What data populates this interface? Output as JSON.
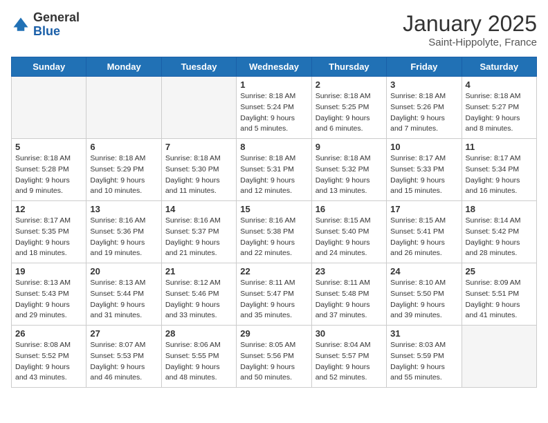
{
  "logo": {
    "general": "General",
    "blue": "Blue"
  },
  "title": "January 2025",
  "subtitle": "Saint-Hippolyte, France",
  "days": [
    "Sunday",
    "Monday",
    "Tuesday",
    "Wednesday",
    "Thursday",
    "Friday",
    "Saturday"
  ],
  "weeks": [
    [
      {
        "day": "",
        "info": ""
      },
      {
        "day": "",
        "info": ""
      },
      {
        "day": "",
        "info": ""
      },
      {
        "day": "1",
        "info": "Sunrise: 8:18 AM\nSunset: 5:24 PM\nDaylight: 9 hours\nand 5 minutes."
      },
      {
        "day": "2",
        "info": "Sunrise: 8:18 AM\nSunset: 5:25 PM\nDaylight: 9 hours\nand 6 minutes."
      },
      {
        "day": "3",
        "info": "Sunrise: 8:18 AM\nSunset: 5:26 PM\nDaylight: 9 hours\nand 7 minutes."
      },
      {
        "day": "4",
        "info": "Sunrise: 8:18 AM\nSunset: 5:27 PM\nDaylight: 9 hours\nand 8 minutes."
      }
    ],
    [
      {
        "day": "5",
        "info": "Sunrise: 8:18 AM\nSunset: 5:28 PM\nDaylight: 9 hours\nand 9 minutes."
      },
      {
        "day": "6",
        "info": "Sunrise: 8:18 AM\nSunset: 5:29 PM\nDaylight: 9 hours\nand 10 minutes."
      },
      {
        "day": "7",
        "info": "Sunrise: 8:18 AM\nSunset: 5:30 PM\nDaylight: 9 hours\nand 11 minutes."
      },
      {
        "day": "8",
        "info": "Sunrise: 8:18 AM\nSunset: 5:31 PM\nDaylight: 9 hours\nand 12 minutes."
      },
      {
        "day": "9",
        "info": "Sunrise: 8:18 AM\nSunset: 5:32 PM\nDaylight: 9 hours\nand 13 minutes."
      },
      {
        "day": "10",
        "info": "Sunrise: 8:17 AM\nSunset: 5:33 PM\nDaylight: 9 hours\nand 15 minutes."
      },
      {
        "day": "11",
        "info": "Sunrise: 8:17 AM\nSunset: 5:34 PM\nDaylight: 9 hours\nand 16 minutes."
      }
    ],
    [
      {
        "day": "12",
        "info": "Sunrise: 8:17 AM\nSunset: 5:35 PM\nDaylight: 9 hours\nand 18 minutes."
      },
      {
        "day": "13",
        "info": "Sunrise: 8:16 AM\nSunset: 5:36 PM\nDaylight: 9 hours\nand 19 minutes."
      },
      {
        "day": "14",
        "info": "Sunrise: 8:16 AM\nSunset: 5:37 PM\nDaylight: 9 hours\nand 21 minutes."
      },
      {
        "day": "15",
        "info": "Sunrise: 8:16 AM\nSunset: 5:38 PM\nDaylight: 9 hours\nand 22 minutes."
      },
      {
        "day": "16",
        "info": "Sunrise: 8:15 AM\nSunset: 5:40 PM\nDaylight: 9 hours\nand 24 minutes."
      },
      {
        "day": "17",
        "info": "Sunrise: 8:15 AM\nSunset: 5:41 PM\nDaylight: 9 hours\nand 26 minutes."
      },
      {
        "day": "18",
        "info": "Sunrise: 8:14 AM\nSunset: 5:42 PM\nDaylight: 9 hours\nand 28 minutes."
      }
    ],
    [
      {
        "day": "19",
        "info": "Sunrise: 8:13 AM\nSunset: 5:43 PM\nDaylight: 9 hours\nand 29 minutes."
      },
      {
        "day": "20",
        "info": "Sunrise: 8:13 AM\nSunset: 5:44 PM\nDaylight: 9 hours\nand 31 minutes."
      },
      {
        "day": "21",
        "info": "Sunrise: 8:12 AM\nSunset: 5:46 PM\nDaylight: 9 hours\nand 33 minutes."
      },
      {
        "day": "22",
        "info": "Sunrise: 8:11 AM\nSunset: 5:47 PM\nDaylight: 9 hours\nand 35 minutes."
      },
      {
        "day": "23",
        "info": "Sunrise: 8:11 AM\nSunset: 5:48 PM\nDaylight: 9 hours\nand 37 minutes."
      },
      {
        "day": "24",
        "info": "Sunrise: 8:10 AM\nSunset: 5:50 PM\nDaylight: 9 hours\nand 39 minutes."
      },
      {
        "day": "25",
        "info": "Sunrise: 8:09 AM\nSunset: 5:51 PM\nDaylight: 9 hours\nand 41 minutes."
      }
    ],
    [
      {
        "day": "26",
        "info": "Sunrise: 8:08 AM\nSunset: 5:52 PM\nDaylight: 9 hours\nand 43 minutes."
      },
      {
        "day": "27",
        "info": "Sunrise: 8:07 AM\nSunset: 5:53 PM\nDaylight: 9 hours\nand 46 minutes."
      },
      {
        "day": "28",
        "info": "Sunrise: 8:06 AM\nSunset: 5:55 PM\nDaylight: 9 hours\nand 48 minutes."
      },
      {
        "day": "29",
        "info": "Sunrise: 8:05 AM\nSunset: 5:56 PM\nDaylight: 9 hours\nand 50 minutes."
      },
      {
        "day": "30",
        "info": "Sunrise: 8:04 AM\nSunset: 5:57 PM\nDaylight: 9 hours\nand 52 minutes."
      },
      {
        "day": "31",
        "info": "Sunrise: 8:03 AM\nSunset: 5:59 PM\nDaylight: 9 hours\nand 55 minutes."
      },
      {
        "day": "",
        "info": ""
      }
    ]
  ]
}
